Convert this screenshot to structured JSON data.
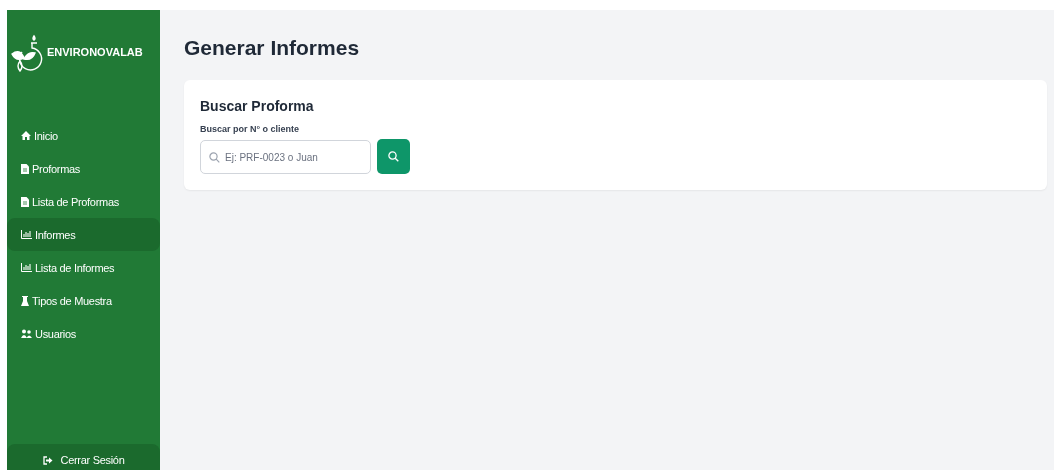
{
  "sidebar": {
    "brand": "ENVIRONOVALAB",
    "items": [
      {
        "label": "Inicio",
        "selected": false
      },
      {
        "label": "Proformas",
        "selected": false
      },
      {
        "label": "Lista de Proformas",
        "selected": false
      },
      {
        "label": "Informes",
        "selected": true
      },
      {
        "label": "Lista de Informes",
        "selected": false
      },
      {
        "label": "Tipos de Muestra",
        "selected": false
      },
      {
        "label": "Usuarios",
        "selected": false
      }
    ],
    "logout": "Cerrar Sesión"
  },
  "page": {
    "title": "Generar Informes"
  },
  "card": {
    "title": "Buscar Proforma",
    "label": "Buscar por N° o cliente",
    "placeholder": "Ej: PRF-0023 o Juan"
  }
}
